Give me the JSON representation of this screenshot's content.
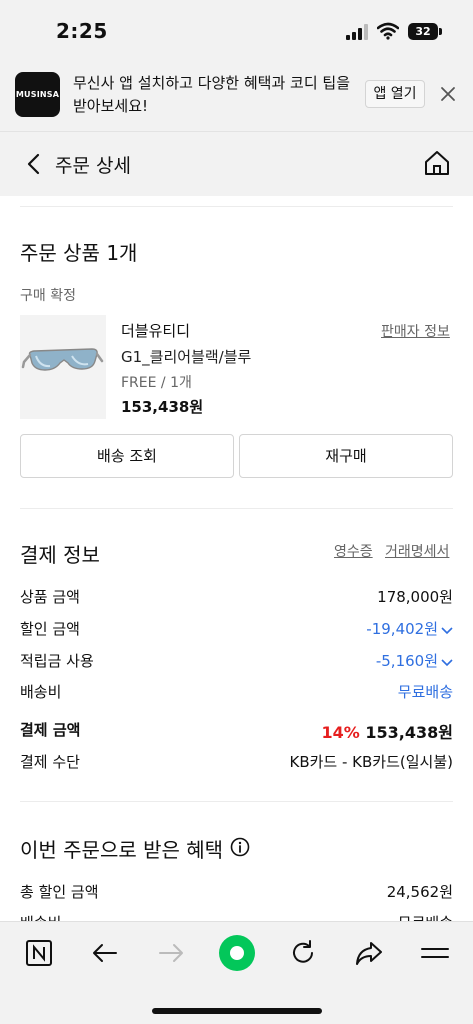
{
  "status_bar": {
    "time": "2:25",
    "battery": "32"
  },
  "app_banner": {
    "logo_text": "MUSINSA",
    "message": "무신사 앱 설치하고 다양한 혜택과 코디 팁을 받아보세요!",
    "open_label": "앱 열기"
  },
  "header": {
    "title": "주문 상세"
  },
  "order_products": {
    "title": "주문 상품 1개",
    "status": "구매 확정",
    "item": {
      "brand": "더블유티디",
      "seller_info_label": "판매자 정보",
      "name": "G1_클리어블랙/블루",
      "option": "FREE / 1개",
      "price": "153,438원"
    },
    "track_label": "배송 조회",
    "reorder_label": "재구매"
  },
  "payment": {
    "title": "결제 정보",
    "receipt_label": "영수증",
    "statement_label": "거래명세서",
    "rows": [
      {
        "label": "상품 금액",
        "value": "178,000원"
      },
      {
        "label": "할인 금액",
        "value": "-19,402원"
      },
      {
        "label": "적립금 사용",
        "value": "-5,160원"
      },
      {
        "label": "배송비",
        "value": "무료배송"
      }
    ],
    "total_label": "결제 금액",
    "total_percent": "14%",
    "total_value": "153,438원",
    "method_label": "결제 수단",
    "method_value": "KB카드 - KB카드(일시불)"
  },
  "benefits": {
    "title": "이번 주문으로 받은 혜택",
    "total_discount_label": "총 할인 금액",
    "total_discount_value": "24,562원",
    "shipping_label": "배송비",
    "shipping_value": "무료배송"
  },
  "colors": {
    "link_blue": "#2f6fe0",
    "discount_red": "#e61e1e",
    "naver_green": "#03c75a"
  },
  "toolbar_icons": [
    "naver-n-icon",
    "back-arrow-icon",
    "forward-arrow-icon",
    "green-dot-icon",
    "refresh-icon",
    "share-icon",
    "menu-icon"
  ]
}
